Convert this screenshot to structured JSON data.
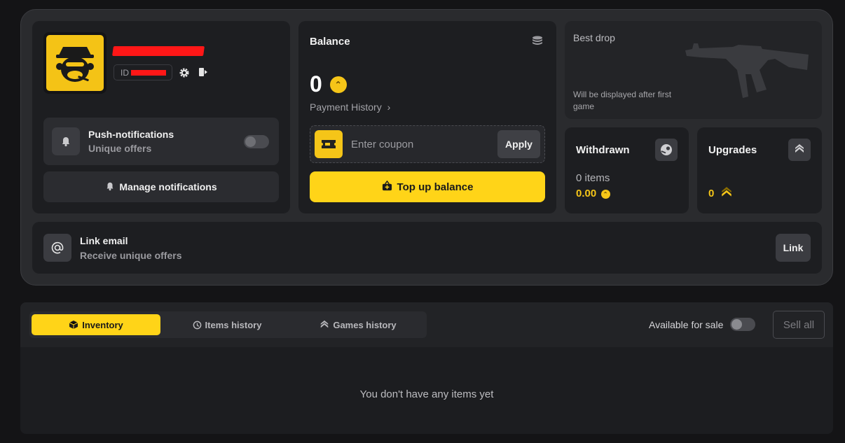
{
  "profile": {
    "id_label": "ID",
    "push": {
      "title": "Push-notifications",
      "subtitle": "Unique offers",
      "enabled": false
    },
    "manage_label": "Manage notifications"
  },
  "balance": {
    "title": "Balance",
    "amount": "0",
    "payment_history": "Payment History",
    "coupon_placeholder": "Enter coupon",
    "apply_label": "Apply",
    "topup_label": "Top up balance"
  },
  "best_drop": {
    "title": "Best drop",
    "subtitle": "Will be displayed after first game"
  },
  "withdrawn": {
    "title": "Withdrawn",
    "items": "0 items",
    "value": "0.00"
  },
  "upgrades": {
    "title": "Upgrades",
    "value": "0"
  },
  "email": {
    "title": "Link email",
    "subtitle": "Receive unique offers",
    "button": "Link"
  },
  "inventory": {
    "tabs": [
      {
        "label": "Inventory",
        "active": true
      },
      {
        "label": "Items history",
        "active": false
      },
      {
        "label": "Games history",
        "active": false
      }
    ],
    "available_for_sale": "Available for sale",
    "available_enabled": false,
    "sell_all": "Sell all",
    "empty_text": "You don't have any items yet"
  },
  "colors": {
    "accent": "#ffd418",
    "background": "#141416",
    "card": "#1d1e21",
    "redaction": "#ff1717"
  },
  "icons": [
    "monkey-avatar-icon",
    "gear-icon",
    "logout-icon",
    "bell-icon",
    "coins-stack-icon",
    "coin-icon",
    "chevron-right-icon",
    "ticket-icon",
    "wallet-plus-icon",
    "steam-icon",
    "upgrade-chevrons-icon",
    "at-sign-icon",
    "box-icon",
    "history-icon",
    "chevrons-up-icon",
    "rifle-icon"
  ]
}
